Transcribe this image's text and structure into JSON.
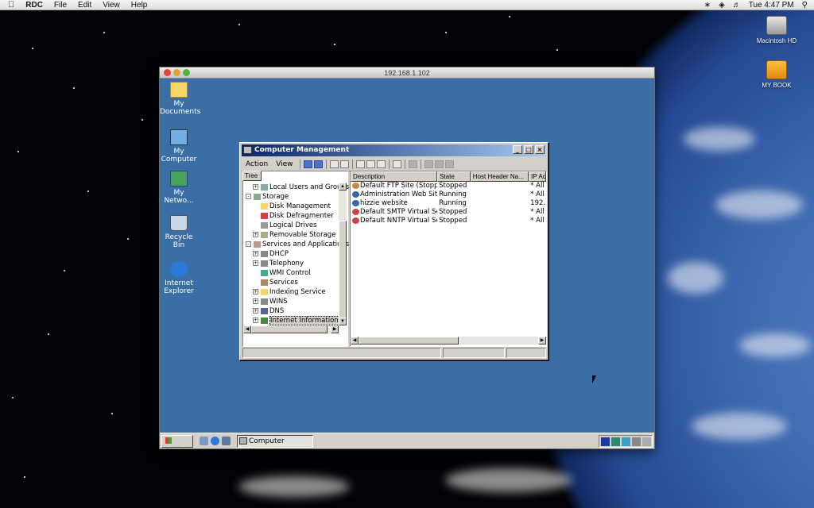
{
  "mac_menubar": {
    "app_name": "RDC",
    "menus": [
      "File",
      "Edit",
      "View",
      "Help"
    ],
    "clock": "Tue 4:47 PM"
  },
  "mac_desktop_icons": [
    {
      "label": "Macintosh HD"
    },
    {
      "label": "MY BOOK"
    }
  ],
  "rdc_window": {
    "title": "192.168.1.102"
  },
  "win_desktop_icons": [
    {
      "label": "My Documents"
    },
    {
      "label": "My Computer"
    },
    {
      "label": "My Netwo..."
    },
    {
      "label": "Recycle Bin"
    },
    {
      "label": "Internet Explorer"
    }
  ],
  "cm_window": {
    "title": "Computer Management",
    "menu": {
      "action": "Action",
      "view": "View"
    },
    "tree_header": "Tree",
    "tree": [
      {
        "label": "Local Users and Groups"
      },
      {
        "label": "Storage"
      },
      {
        "label": "Disk Management"
      },
      {
        "label": "Disk Defragmenter"
      },
      {
        "label": "Logical Drives"
      },
      {
        "label": "Removable Storage"
      },
      {
        "label": "Services and Applications"
      },
      {
        "label": "DHCP"
      },
      {
        "label": "Telephony"
      },
      {
        "label": "WMI Control"
      },
      {
        "label": "Services"
      },
      {
        "label": "Indexing Service"
      },
      {
        "label": "WINS"
      },
      {
        "label": "DNS"
      },
      {
        "label": "Internet Information Services"
      }
    ],
    "columns": [
      "Description",
      "State",
      "Host Header Na...",
      "IP Ad"
    ],
    "rows": [
      {
        "description": "Default FTP Site (Stopp...",
        "state": "Stopped",
        "host": "",
        "ip": "* All"
      },
      {
        "description": "Administration Web Site",
        "state": "Running",
        "host": "",
        "ip": "* All"
      },
      {
        "description": "hizzie website",
        "state": "Running",
        "host": "",
        "ip": "192."
      },
      {
        "description": "Default SMTP Virtual Ser...",
        "state": "Stopped",
        "host": "",
        "ip": "* All"
      },
      {
        "description": "Default NNTP Virtual Ser...",
        "state": "Stopped",
        "host": "",
        "ip": "* All"
      }
    ]
  },
  "taskbar": {
    "start_label": "Start",
    "task_label": "Computer Mana..."
  },
  "colors": {
    "win_desktop": "#3a6ea5",
    "title_active": "#0a246a"
  }
}
